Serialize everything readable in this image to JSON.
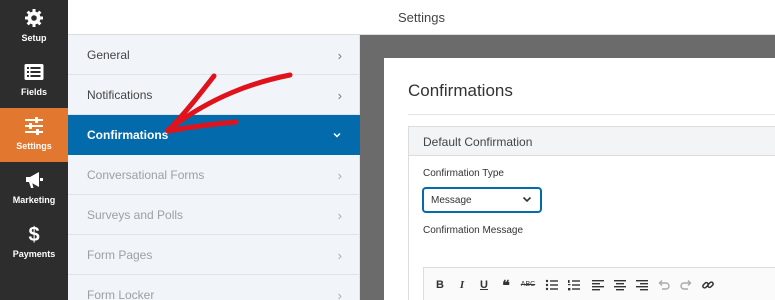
{
  "header": {
    "title": "Settings"
  },
  "rail": {
    "items": [
      {
        "label": "Setup",
        "icon": "gear-icon"
      },
      {
        "label": "Fields",
        "icon": "fields-list-icon"
      },
      {
        "label": "Settings",
        "icon": "sliders-icon",
        "active": true
      },
      {
        "label": "Marketing",
        "icon": "megaphone-icon"
      },
      {
        "label": "Payments",
        "icon": "dollar-icon"
      }
    ],
    "active_color": "#e27730",
    "bg_color": "#2d2d2d"
  },
  "subnav": {
    "items": [
      {
        "label": "General"
      },
      {
        "label": "Notifications"
      },
      {
        "label": "Confirmations",
        "active": true
      },
      {
        "label": "Conversational Forms",
        "muted": true
      },
      {
        "label": "Surveys and Polls",
        "muted": true
      },
      {
        "label": "Form Pages",
        "muted": true
      },
      {
        "label": "Form Locker",
        "muted": true
      }
    ],
    "active_color": "#036aab"
  },
  "panel": {
    "title": "Confirmations",
    "card_title": "Default Confirmation",
    "type_label": "Confirmation Type",
    "type_value": "Message",
    "message_label": "Confirmation Message"
  },
  "toolbar": {
    "buttons": [
      "bold-icon",
      "italic-icon",
      "underline-icon",
      "blockquote-icon",
      "strikethrough-icon",
      "bullet-list-icon",
      "numbered-list-icon",
      "align-left-icon",
      "align-center-icon",
      "align-right-icon",
      "undo-icon",
      "redo-icon",
      "link-icon"
    ],
    "bold": "B",
    "italic": "I",
    "underline": "U",
    "quote": "❝",
    "strike": "ABC"
  },
  "annotation": {
    "color": "#e0121b"
  }
}
